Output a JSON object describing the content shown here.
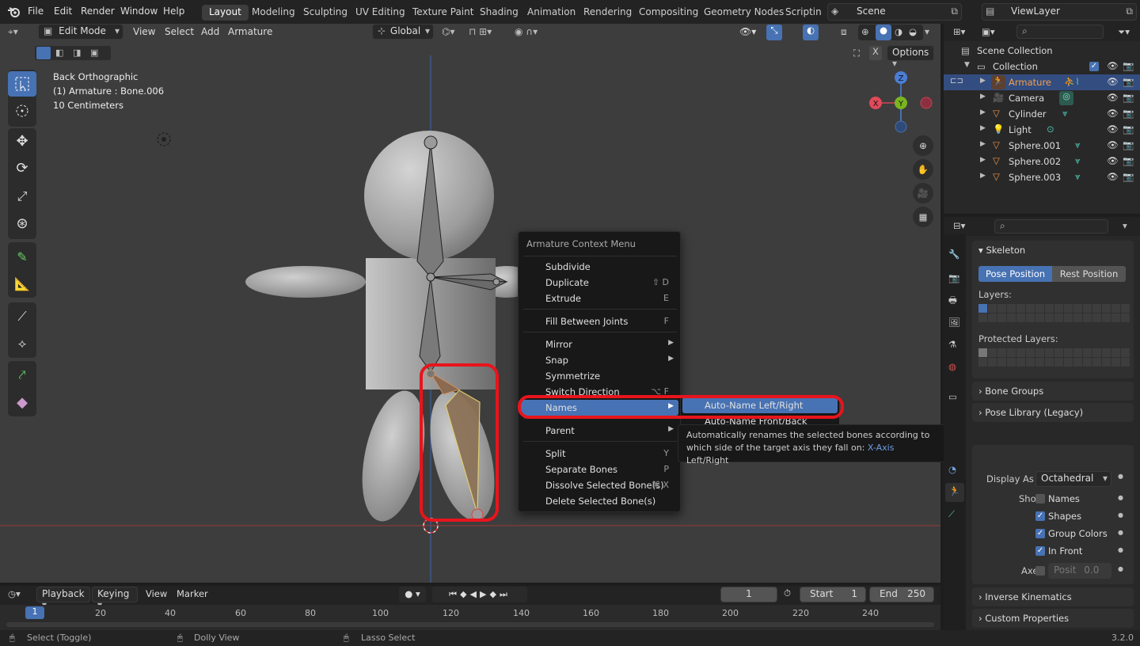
{
  "menubar": {
    "items": [
      "File",
      "Edit",
      "Render",
      "Window",
      "Help"
    ],
    "workspaces": [
      "Layout",
      "Modeling",
      "Sculpting",
      "UV Editing",
      "Texture Paint",
      "Shading",
      "Animation",
      "Rendering",
      "Compositing",
      "Geometry Nodes",
      "Scripting"
    ],
    "active_workspace": "Layout",
    "scene": "Scene",
    "view_layer": "ViewLayer"
  },
  "viewport": {
    "mode": "Edit Mode",
    "header_menus": [
      "View",
      "Select",
      "Add",
      "Armature"
    ],
    "transform_orientation": "Global",
    "options_label": "Options",
    "overlay_info": {
      "view_name": "Back Orthographic",
      "object_info": "(1) Armature : Bone.006",
      "scale": "10 Centimeters"
    },
    "gizmo_axes": {
      "z": "Z",
      "x": "X",
      "y": "Y"
    }
  },
  "context_menu": {
    "title": "Armature Context Menu",
    "items": [
      {
        "label": "Subdivide",
        "shortcut": ""
      },
      {
        "label": "Duplicate",
        "shortcut": "⇧ D"
      },
      {
        "label": "Extrude",
        "shortcut": "E"
      },
      {
        "label": "Fill Between Joints",
        "shortcut": "F"
      },
      {
        "label": "Mirror",
        "shortcut": ""
      },
      {
        "label": "Snap",
        "shortcut": ""
      },
      {
        "label": "Symmetrize",
        "shortcut": ""
      },
      {
        "label": "Switch Direction",
        "shortcut": "⌥ F"
      },
      {
        "label": "Names",
        "shortcut": ""
      },
      {
        "label": "Parent",
        "shortcut": ""
      },
      {
        "label": "Split",
        "shortcut": "Y"
      },
      {
        "label": "Separate Bones",
        "shortcut": "P"
      },
      {
        "label": "Dissolve Selected Bone(s)",
        "shortcut": "⌘ X"
      },
      {
        "label": "Delete Selected Bone(s)",
        "shortcut": ""
      }
    ],
    "highlight_color": "#4772b3",
    "annotation_color": "#e8141c"
  },
  "names_submenu": {
    "items": [
      "Auto-Name Left/Right",
      "Auto-Name Front/Back"
    ]
  },
  "tooltip": {
    "text": "Automatically renames the selected bones according to which side of the target axis they fall on:",
    "value": "X-Axis",
    "value2": "Left/Right"
  },
  "outliner": {
    "scene_collection": "Scene Collection",
    "collection": "Collection",
    "objects": [
      "Armature",
      "Camera",
      "Cylinder",
      "Light",
      "Sphere.001",
      "Sphere.002",
      "Sphere.003"
    ],
    "selected": "Armature"
  },
  "properties": {
    "panel_title": "Skeleton",
    "pose_position": "Pose Position",
    "rest_position": "Rest Position",
    "layers_label": "Layers:",
    "protected_layers_label": "Protected Layers:",
    "bone_groups": "Bone Groups",
    "pose_library": "Pose Library (Legacy)",
    "display_as_label": "Display As",
    "display_as_value": "Octahedral",
    "show_label": "Show",
    "show_names": "Names",
    "show_shapes": "Shapes",
    "show_group_colors": "Group Colors",
    "show_in_front": "In Front",
    "axes_label": "Axes",
    "axes_position": "Posit",
    "axes_value": "0.0",
    "inverse_kinematics": "Inverse Kinematics",
    "custom_properties": "Custom Properties"
  },
  "timeline": {
    "menus": [
      "Playback",
      "Keying",
      "View",
      "Marker"
    ],
    "current_frame": "1",
    "start_label": "Start",
    "start_value": "1",
    "end_label": "End",
    "end_value": "250",
    "ruler_ticks": [
      "1",
      "20",
      "40",
      "60",
      "80",
      "100",
      "120",
      "140",
      "160",
      "180",
      "200",
      "220",
      "240"
    ]
  },
  "statusbar": {
    "select": "Select (Toggle)",
    "dolly": "Dolly View",
    "lasso": "Lasso Select",
    "version": "3.2.0"
  }
}
